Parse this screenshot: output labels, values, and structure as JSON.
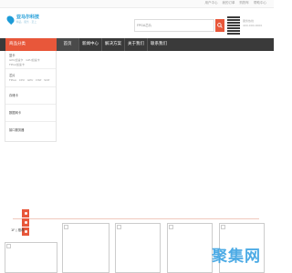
{
  "topbar": {
    "links": [
      "用户中心",
      "我的订单",
      "购物车",
      "帮助中心"
    ]
  },
  "logo": {
    "name": "亚马尔科技",
    "tagline": "精品 · 服务 · 至上"
  },
  "search": {
    "placeholder": "FPGA芯片"
  },
  "contact": {
    "line1": "服务热线",
    "line2": "400-000-0000"
  },
  "nav": {
    "category_tab": "商品分类",
    "items": [
      "首页",
      "新闻中心",
      "解决方案",
      "关于我们",
      "联系我们"
    ]
  },
  "categories": [
    {
      "title": "显卡",
      "sub": [
        "GPU加速卡",
        "GPU加速卡",
        "FPGA加速卡"
      ]
    },
    {
      "title": "芯片",
      "sub": [
        "FPGA",
        "CPU",
        "GPU",
        "DSP",
        "SOP"
      ]
    },
    {
      "title": "存储卡",
      "sub": []
    },
    {
      "title": "数据网卡",
      "sub": []
    },
    {
      "title": "接口服务器",
      "sub": []
    }
  ],
  "section": {
    "title": "1F | 推荐"
  },
  "watermark": "聚集网",
  "colors": {
    "accent": "#e8573a",
    "nav_bg": "#3a3a3a",
    "brand_blue": "#1d9bd7"
  }
}
